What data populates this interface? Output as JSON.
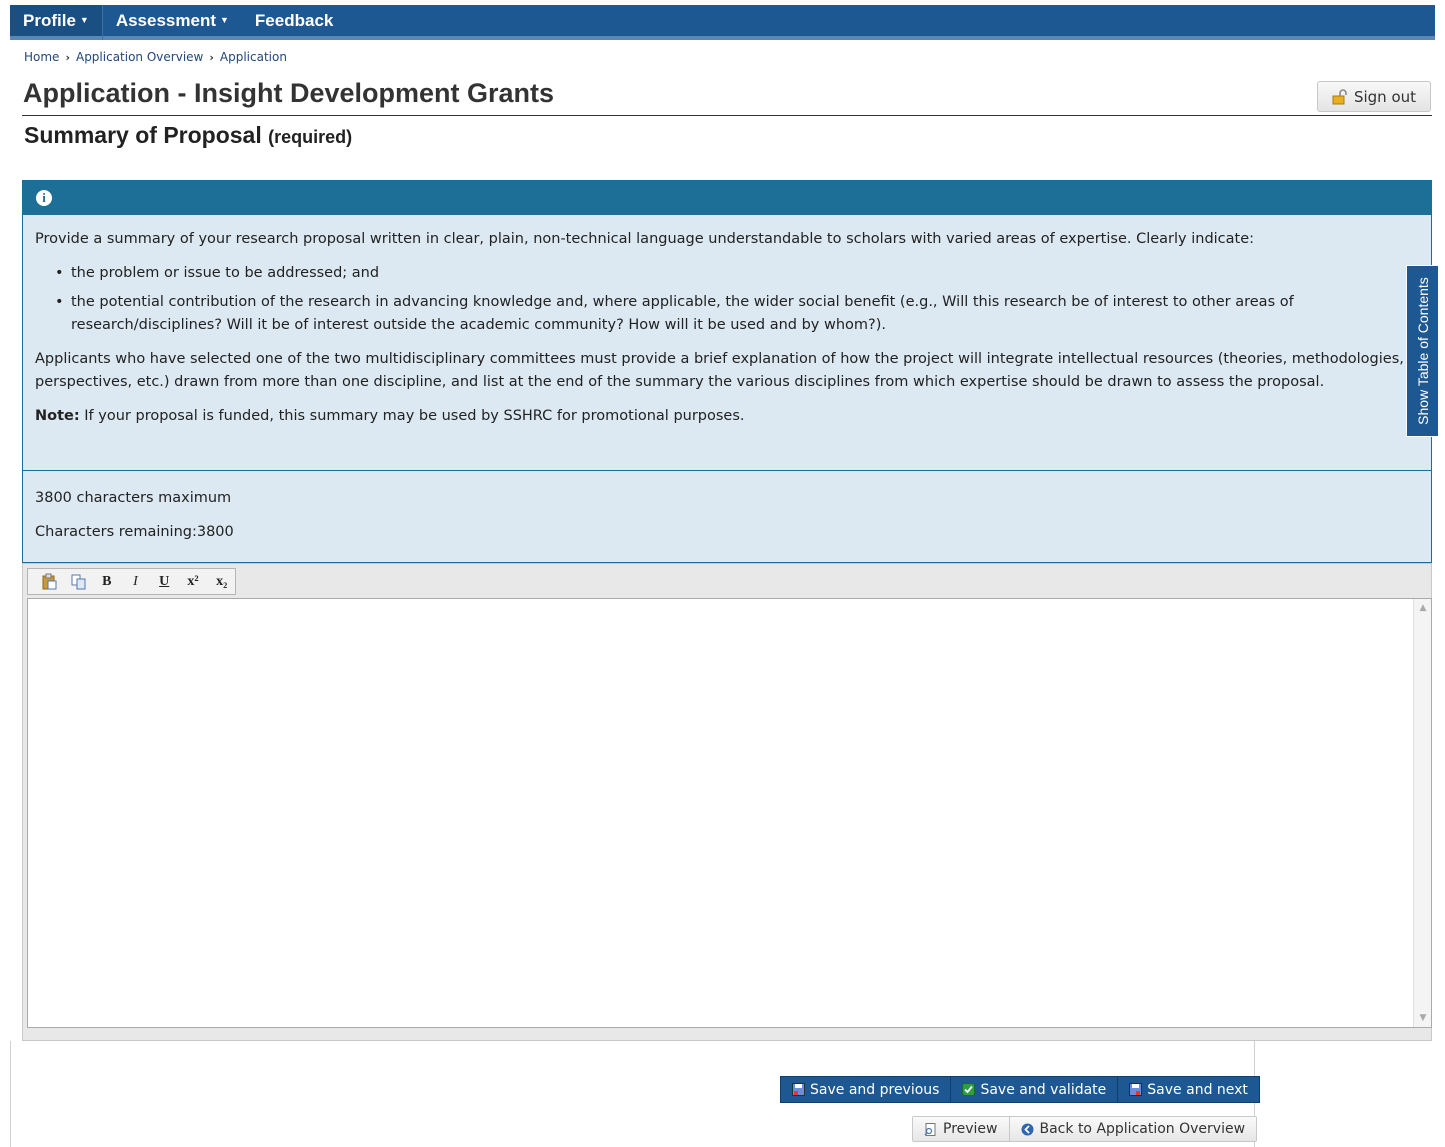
{
  "nav": {
    "profile": "Profile",
    "assessment": "Assessment",
    "feedback": "Feedback"
  },
  "breadcrumb": {
    "home": "Home",
    "overview": "Application Overview",
    "current": "Application"
  },
  "header": {
    "title": "Application - Insight Development Grants",
    "signout": "Sign out"
  },
  "section": {
    "title": "Summary of Proposal",
    "required": "(required)"
  },
  "info": {
    "intro": "Provide a summary of your research proposal written in clear, plain, non-technical language understandable to scholars with varied areas of expertise. Clearly indicate:",
    "bullet1": "the problem or issue to be addressed; and",
    "bullet2": "the potential contribution of the research in advancing knowledge and, where applicable, the wider social benefit (e.g., Will this research be of interest to other areas of research/disciplines? Will it be of interest outside the academic community? How will it be used and by whom?).",
    "multidisciplinary": "Applicants who have selected one of the two multidisciplinary committees must provide a brief explanation of how the project will integrate intellectual resources (theories, methodologies, perspectives, etc.) drawn from more than one discipline, and list at the end of the summary the various disciplines from which expertise should be drawn to assess the proposal.",
    "note_label": "Note:",
    "note_text": "If your proposal is funded, this summary may be used by SSHRC for promotional purposes.",
    "max_chars": "3800 characters maximum",
    "remaining": "Characters remaining:3800"
  },
  "toc": {
    "label": "Show Table of Contents"
  },
  "toolbar": {
    "bold": "B",
    "italic": "I",
    "underline": "U",
    "superscript": "x²",
    "subscript": "x₂"
  },
  "editor": {
    "value": ""
  },
  "actions": {
    "save_previous": "Save and previous",
    "save_validate": "Save and validate",
    "save_next": "Save and next",
    "preview": "Preview",
    "back": "Back to Application Overview"
  },
  "colors": {
    "navbar": "#1d5893",
    "info_header": "#1e6f97",
    "info_bg": "#dce9f2",
    "validate_check": "#2e9e3e"
  }
}
